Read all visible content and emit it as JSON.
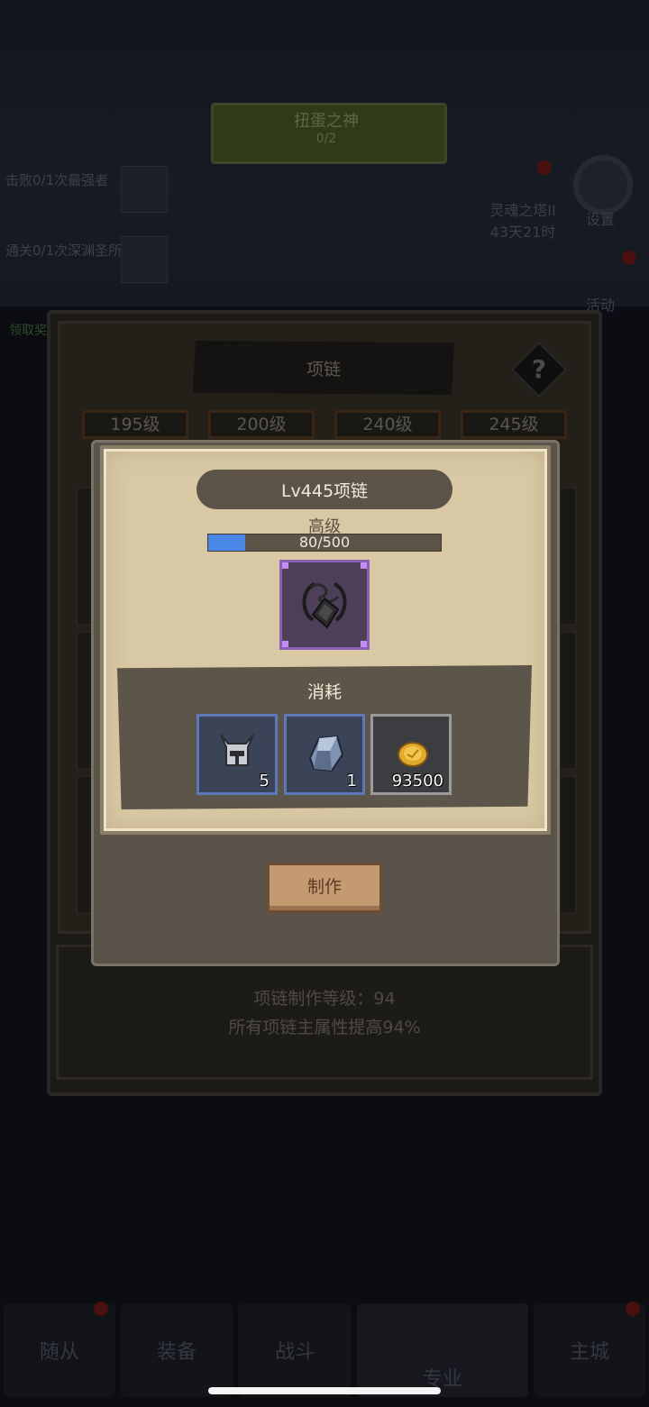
{
  "background": {
    "banner_title": "扭蛋之神",
    "banner_sub": "0/2",
    "quests": [
      "击败0/1次最强者",
      "通关0/1次深渊圣所"
    ],
    "event_title": "灵魂之塔II",
    "event_timer": "43天21时",
    "settings_label": "设置",
    "activity_label": "活动",
    "left_small": "领取奖励"
  },
  "outer_panel": {
    "title": "项链",
    "help_symbol": "?",
    "level_tabs": [
      "195级",
      "200级",
      "240级",
      "245级"
    ],
    "craft_level_label": "项链制作等级：94",
    "bonus_text": "所有项链主属性提高94%"
  },
  "popup": {
    "title": "Lv445项链",
    "grade": "高级",
    "progress": {
      "current": 80,
      "max": 500,
      "text": "80/500"
    },
    "item_icon": "necklace-icon",
    "cost_title": "消耗",
    "materials": [
      {
        "icon": "helmet-icon",
        "count": "5",
        "rarity": "blue"
      },
      {
        "icon": "ore-icon",
        "count": "1",
        "rarity": "blue"
      },
      {
        "icon": "gold-coin-icon",
        "count": "93500",
        "rarity": "grey"
      }
    ],
    "craft_button": "制作"
  },
  "bottom_nav": [
    "随从",
    "装备",
    "战斗",
    "专业",
    "主城"
  ],
  "colors": {
    "progress_fill": "#4a88e8",
    "rare_border": "#8a5fb8",
    "blue_border": "#5c78b8"
  }
}
